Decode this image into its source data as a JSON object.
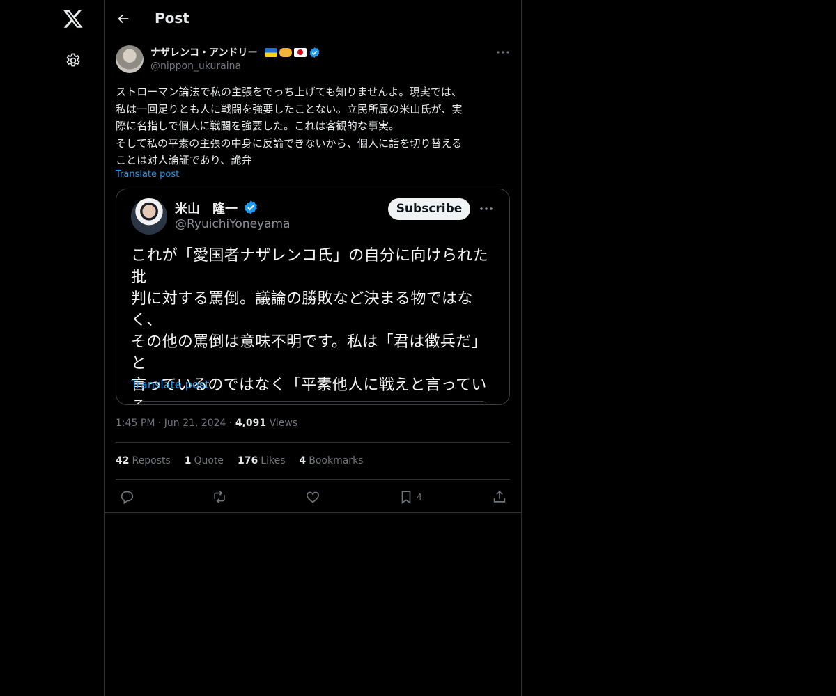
{
  "header": {
    "title": "Post"
  },
  "post": {
    "author_name": "ナザレンコ・アンドリー",
    "author_handle": "@nippon_ukuraina",
    "text": "ストローマン論法で私の主張をでっち上げても知りませんよ。現実では、\n私は一回足りとも人に戦闘を強要したことない。立民所属の米山氏が、実\n際に名指しで個人に戦闘を強要した。これは客観的な事実。\nそして私の平素の主張の中身に反論できないから、個人に話を切り替える\nことは対人論証であり、詭弁",
    "translate_label": "Translate post",
    "time": "1:45 PM",
    "date": "Jun 21, 2024",
    "views_count": "4,091",
    "views_label": "Views"
  },
  "quoted_image": {
    "name": "米山　隆一",
    "handle": "@RyuichiYoneyama",
    "subscribe_label": "Subscribe",
    "text": "これが「愛国者ナザレンコ氏」の自分に向けられた批\n判に対する罵倒。議論の勝敗など決まる物ではなく、\nその他の罵倒は意味不明です。私は「君は徴兵だ」と\n言っているのではなく「平素他人に戦えと言っている\n以上貴方自身が戦うべきだし、貴方が戦わないなら他\n人にも言うべきでない」言っています。",
    "translate_label": "Translate post"
  },
  "stats": [
    {
      "count": "42",
      "label": "Reposts"
    },
    {
      "count": "1",
      "label": "Quote"
    },
    {
      "count": "176",
      "label": "Likes"
    },
    {
      "count": "4",
      "label": "Bookmarks"
    }
  ],
  "actions": {
    "bookmark_count": "4"
  },
  "colors": {
    "accent": "#1d9bf0",
    "background": "#000000",
    "muted": "#71767b",
    "border": "#2f3336"
  },
  "icons": [
    "x-logo-icon",
    "gear-icon",
    "back-arrow-icon",
    "verified-icon",
    "more-icon",
    "reply-icon",
    "repost-icon",
    "like-icon",
    "bookmark-icon",
    "share-icon"
  ]
}
